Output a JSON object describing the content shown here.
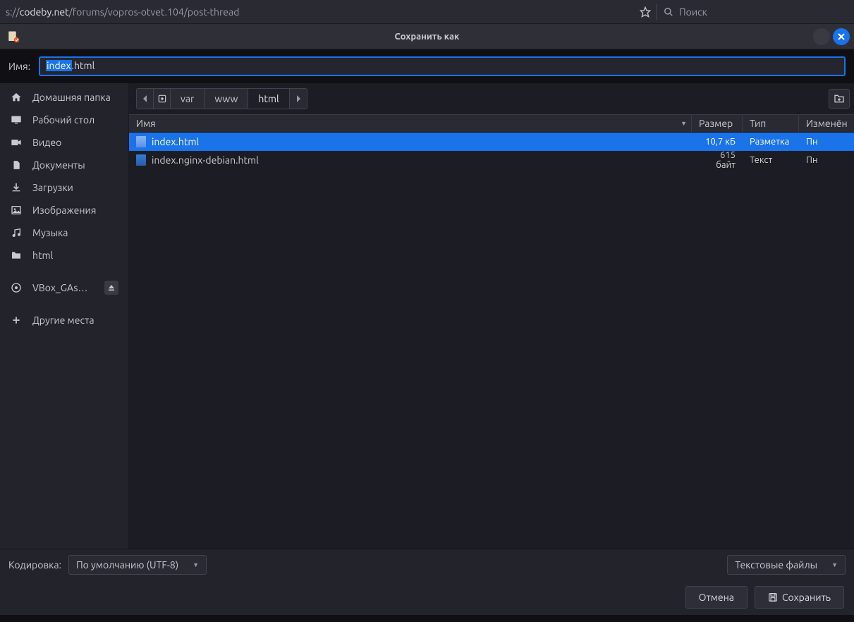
{
  "browser": {
    "url_prefix": "s://",
    "url_host": "codeby.net",
    "url_path": "/forums/vopros-otvet.104/post-thread",
    "search_placeholder": "Поиск"
  },
  "dialog": {
    "title": "Сохранить как",
    "filename_label": "Имя:",
    "filename_selected": "index",
    "filename_rest": ".html",
    "encoding_label": "Кодировка:",
    "encoding_value": "По умолчанию (UTF-8)",
    "filetype_value": "Текстовые файлы",
    "cancel": "Отмена",
    "save": "Сохранить"
  },
  "sidebar": {
    "items": [
      {
        "label": "Домашняя папка",
        "icon": "home"
      },
      {
        "label": "Рабочий стол",
        "icon": "desktop"
      },
      {
        "label": "Видео",
        "icon": "video"
      },
      {
        "label": "Документы",
        "icon": "document"
      },
      {
        "label": "Загрузки",
        "icon": "download"
      },
      {
        "label": "Изображения",
        "icon": "image"
      },
      {
        "label": "Музыка",
        "icon": "music"
      },
      {
        "label": "html",
        "icon": "folder"
      }
    ],
    "drive": {
      "label": "VBox_GAs…",
      "icon": "disc"
    },
    "other": {
      "label": "Другие места",
      "icon": "plus"
    }
  },
  "breadcrumb": {
    "segments": [
      "var",
      "www",
      "html"
    ],
    "active_index": 2
  },
  "columns": {
    "name": "Имя",
    "size": "Размер",
    "type": "Тип",
    "modified": "Изменён"
  },
  "files": [
    {
      "name": "index.html",
      "size": "10,7 кБ",
      "type": "Разметка",
      "modified": "Пн",
      "selected": true
    },
    {
      "name": "index.nginx-debian.html",
      "size": "615 байт",
      "type": "Текст",
      "modified": "Пн",
      "selected": false
    }
  ]
}
